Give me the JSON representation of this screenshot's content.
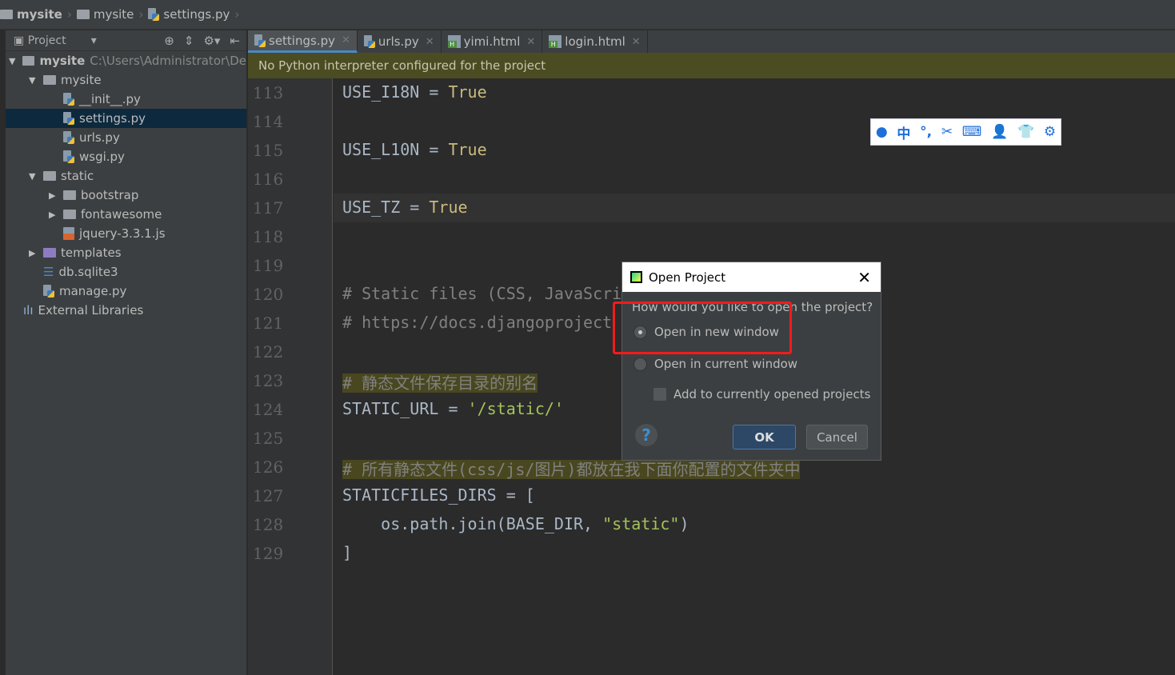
{
  "breadcrumb": [
    "mysite",
    "mysite",
    "settings.py"
  ],
  "project_panel": {
    "title": "Project",
    "tree": [
      {
        "label": "mysite",
        "path": "C:\\Users\\Administrator\\De",
        "level": 0,
        "type": "folder",
        "expanded": true
      },
      {
        "label": "mysite",
        "level": 1,
        "type": "folder",
        "expanded": true
      },
      {
        "label": "__init__.py",
        "level": 2,
        "type": "py"
      },
      {
        "label": "settings.py",
        "level": 2,
        "type": "py",
        "selected": true
      },
      {
        "label": "urls.py",
        "level": 2,
        "type": "py"
      },
      {
        "label": "wsgi.py",
        "level": 2,
        "type": "py"
      },
      {
        "label": "static",
        "level": 1,
        "type": "folder",
        "expanded": true
      },
      {
        "label": "bootstrap",
        "level": 2,
        "type": "folder",
        "expanded": false
      },
      {
        "label": "fontawesome",
        "level": 2,
        "type": "folder",
        "expanded": false
      },
      {
        "label": "jquery-3.3.1.js",
        "level": 2,
        "type": "js"
      },
      {
        "label": "templates",
        "level": 1,
        "type": "folder",
        "expanded": false
      },
      {
        "label": "db.sqlite3",
        "level": 1,
        "type": "db"
      },
      {
        "label": "manage.py",
        "level": 1,
        "type": "py"
      },
      {
        "label": "External Libraries",
        "level": 0,
        "type": "lib"
      }
    ]
  },
  "tabs": [
    {
      "label": "settings.py",
      "icon": "python-file",
      "active": true
    },
    {
      "label": "urls.py",
      "icon": "python-file"
    },
    {
      "label": "yimi.html",
      "icon": "html-file"
    },
    {
      "label": "login.html",
      "icon": "html-file"
    }
  ],
  "banner": "No Python interpreter configured for the project",
  "code": [
    {
      "n": "113",
      "t": [
        [
          "USE_I18N = ",
          ""
        ],
        [
          "True",
          "kw"
        ]
      ]
    },
    {
      "n": "114",
      "t": []
    },
    {
      "n": "115",
      "t": [
        [
          "USE_L10N = ",
          ""
        ],
        [
          "True",
          "kw"
        ]
      ]
    },
    {
      "n": "116",
      "t": []
    },
    {
      "n": "117",
      "t": [
        [
          "USE_TZ = ",
          ""
        ],
        [
          "True",
          "kw"
        ]
      ]
    },
    {
      "n": "118",
      "t": []
    },
    {
      "n": "119",
      "t": []
    },
    {
      "n": "120",
      "t": [
        [
          "# Static files (CSS, JavaScri",
          "cm"
        ],
        [
          "                 ",
          ""
        ]
      ]
    },
    {
      "n": "121",
      "t": [
        [
          "# https://docs.djangoproject",
          "cm"
        ],
        [
          "            ",
          ""
        ],
        [
          "les/",
          "cm"
        ]
      ]
    },
    {
      "n": "122",
      "t": []
    },
    {
      "n": "123",
      "t": [
        [
          "# 静态文件保存目录的别名",
          "cm hl"
        ]
      ]
    },
    {
      "n": "124",
      "t": [
        [
          "STATIC_URL = ",
          ""
        ],
        [
          "'/static/'",
          "str"
        ]
      ]
    },
    {
      "n": "125",
      "t": []
    },
    {
      "n": "126",
      "t": [
        [
          "# 所有静态文件(css/js/图片)都放在我下面你配置的文件夹中",
          "cm hl"
        ]
      ]
    },
    {
      "n": "127",
      "t": [
        [
          "STATICFILES_DIRS = [",
          ""
        ]
      ]
    },
    {
      "n": "128",
      "t": [
        [
          "    os.path.join(BASE_DIR, ",
          ""
        ],
        [
          "\"static\"",
          "str"
        ],
        [
          ")",
          ""
        ]
      ]
    },
    {
      "n": "129",
      "t": [
        [
          "]",
          ""
        ]
      ]
    }
  ],
  "dialog": {
    "title": "Open Project",
    "question": "How would you like to open the project?",
    "option_new": "Open in new window",
    "option_current": "Open in current window",
    "add_checkbox": "Add to currently opened projects",
    "ok": "OK",
    "cancel": "Cancel",
    "help": "?",
    "selected": "new"
  },
  "ime_toolbar": [
    "user",
    "中",
    "°,",
    "✂",
    "⌨",
    "👤",
    "👕",
    "⚙"
  ]
}
